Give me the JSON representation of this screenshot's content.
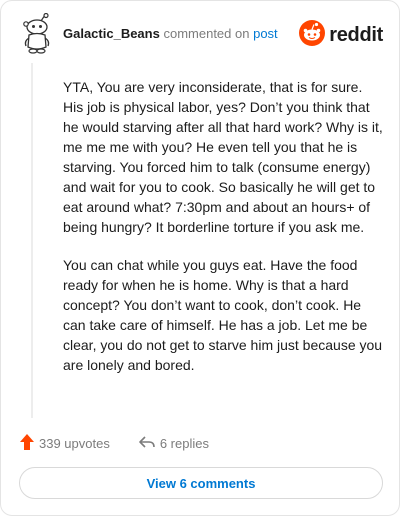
{
  "comment": {
    "username": "Galactic_Beans",
    "verb": "commented on",
    "post_link": "post",
    "paragraphs": [
      "YTA, You are very inconsiderate, that is for sure. His job is physical labor, yes? Don’t you think that he would starving after all that hard work? Why is it, me me me with you? He even tell you that he is starving. You forced him to talk (consume energy) and wait for you to cook. So basically he will get to eat around what? 7:30pm and about an hours+ of being hungry? It borderline torture if you ask me.",
      "You can chat while you guys eat. Have the food ready for when he is home. Why is that a hard concept? You don’t want to cook, don’t cook. He can take care of himself. He has a job. Let me be clear, you do not get to starve him just because you are lonely and bored."
    ]
  },
  "brand": {
    "wordmark": "reddit",
    "color": "#ff4500"
  },
  "actions": {
    "upvotes": "339 upvotes",
    "replies": "6 replies"
  },
  "footer": {
    "view_label": "View 6 comments"
  },
  "icons": {
    "avatar": "snoo-avatar-icon",
    "logo": "reddit-logo-icon",
    "upvote": "upvote-arrow-icon",
    "reply": "reply-arrow-icon"
  }
}
